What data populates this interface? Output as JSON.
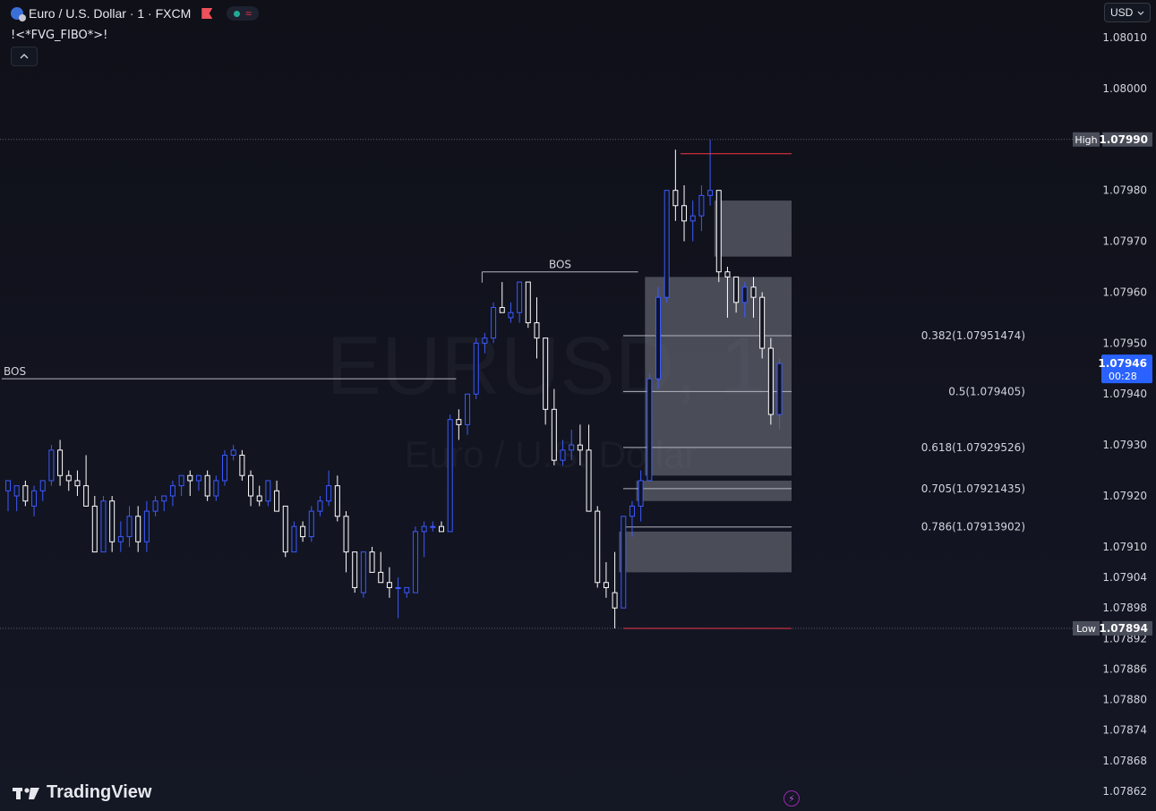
{
  "header": {
    "title": "Euro / U.S. Dollar · 1 · FXCM",
    "indicator": "!<*FVG_FIBO*>!",
    "currency": "USD"
  },
  "brand": {
    "logo_text": "TradingView"
  },
  "watermark": {
    "symbol": "EURUSD, 1",
    "description": "Euro / U.S. Dollar"
  },
  "colors": {
    "bg": "#121420",
    "bull_candle": "#3d5afe",
    "bear_candle": "#ffffff",
    "high_low_line": "#f23645",
    "zone": "#787b86",
    "price_tag": "#2962ff",
    "label_tag": "#4a4e5a"
  },
  "chart_data": {
    "type": "candlestick",
    "symbol": "EURUSD",
    "timeframe": "1",
    "ylim": [
      1.07859,
      1.08015
    ],
    "y_ticks": [
      "1.08010",
      "1.08000",
      "1.07980",
      "1.07970",
      "1.07960",
      "1.07950",
      "1.07940",
      "1.07930",
      "1.07920",
      "1.07910",
      "1.07904",
      "1.07898",
      "1.07892",
      "1.07886",
      "1.07880",
      "1.07874",
      "1.07868",
      "1.07862"
    ],
    "candles": [
      {
        "o": 1.07921,
        "h": 1.07923,
        "l": 1.07917,
        "c": 1.07923
      },
      {
        "o": 1.0792,
        "h": 1.07922,
        "l": 1.07917,
        "c": 1.07922
      },
      {
        "o": 1.07922,
        "h": 1.07923,
        "l": 1.07918,
        "c": 1.07919
      },
      {
        "o": 1.07918,
        "h": 1.07922,
        "l": 1.07916,
        "c": 1.07921
      },
      {
        "o": 1.07921,
        "h": 1.07923,
        "l": 1.07919,
        "c": 1.07923
      },
      {
        "o": 1.07923,
        "h": 1.0793,
        "l": 1.07922,
        "c": 1.07929
      },
      {
        "o": 1.07929,
        "h": 1.07931,
        "l": 1.07922,
        "c": 1.07924
      },
      {
        "o": 1.07924,
        "h": 1.07925,
        "l": 1.07921,
        "c": 1.07923
      },
      {
        "o": 1.07923,
        "h": 1.07925,
        "l": 1.0792,
        "c": 1.07922
      },
      {
        "o": 1.07922,
        "h": 1.07928,
        "l": 1.07918,
        "c": 1.07918
      },
      {
        "o": 1.07918,
        "h": 1.0792,
        "l": 1.07909,
        "c": 1.07909
      },
      {
        "o": 1.07909,
        "h": 1.0792,
        "l": 1.07909,
        "c": 1.07919
      },
      {
        "o": 1.07919,
        "h": 1.0792,
        "l": 1.07909,
        "c": 1.07911
      },
      {
        "o": 1.07911,
        "h": 1.07915,
        "l": 1.07909,
        "c": 1.07912
      },
      {
        "o": 1.07912,
        "h": 1.07918,
        "l": 1.0791,
        "c": 1.07916
      },
      {
        "o": 1.07916,
        "h": 1.07918,
        "l": 1.07909,
        "c": 1.07911
      },
      {
        "o": 1.07911,
        "h": 1.07919,
        "l": 1.07909,
        "c": 1.07917
      },
      {
        "o": 1.07917,
        "h": 1.0792,
        "l": 1.07916,
        "c": 1.07919
      },
      {
        "o": 1.07919,
        "h": 1.0792,
        "l": 1.07917,
        "c": 1.0792
      },
      {
        "o": 1.0792,
        "h": 1.07923,
        "l": 1.07918,
        "c": 1.07922
      },
      {
        "o": 1.07922,
        "h": 1.07924,
        "l": 1.0792,
        "c": 1.07924
      },
      {
        "o": 1.07924,
        "h": 1.07925,
        "l": 1.0792,
        "c": 1.07923
      },
      {
        "o": 1.07923,
        "h": 1.07924,
        "l": 1.07921,
        "c": 1.07924
      },
      {
        "o": 1.07924,
        "h": 1.07925,
        "l": 1.07919,
        "c": 1.0792
      },
      {
        "o": 1.0792,
        "h": 1.07924,
        "l": 1.07919,
        "c": 1.07923
      },
      {
        "o": 1.07923,
        "h": 1.07929,
        "l": 1.07922,
        "c": 1.07928
      },
      {
        "o": 1.07928,
        "h": 1.0793,
        "l": 1.07927,
        "c": 1.07929
      },
      {
        "o": 1.07928,
        "h": 1.07929,
        "l": 1.07923,
        "c": 1.07924
      },
      {
        "o": 1.07924,
        "h": 1.07925,
        "l": 1.07918,
        "c": 1.0792
      },
      {
        "o": 1.0792,
        "h": 1.07922,
        "l": 1.07918,
        "c": 1.07919
      },
      {
        "o": 1.07919,
        "h": 1.07923,
        "l": 1.07918,
        "c": 1.07923
      },
      {
        "o": 1.07921,
        "h": 1.07923,
        "l": 1.07917,
        "c": 1.07917
      },
      {
        "o": 1.07918,
        "h": 1.07918,
        "l": 1.07908,
        "c": 1.07909
      },
      {
        "o": 1.07909,
        "h": 1.07915,
        "l": 1.07909,
        "c": 1.07914
      },
      {
        "o": 1.07914,
        "h": 1.07915,
        "l": 1.07911,
        "c": 1.07912
      },
      {
        "o": 1.07912,
        "h": 1.07918,
        "l": 1.07911,
        "c": 1.07917
      },
      {
        "o": 1.07917,
        "h": 1.0792,
        "l": 1.07916,
        "c": 1.07919
      },
      {
        "o": 1.07919,
        "h": 1.07925,
        "l": 1.07918,
        "c": 1.07922
      },
      {
        "o": 1.07922,
        "h": 1.07924,
        "l": 1.07915,
        "c": 1.07916
      },
      {
        "o": 1.07916,
        "h": 1.07917,
        "l": 1.07905,
        "c": 1.07909
      },
      {
        "o": 1.07909,
        "h": 1.07909,
        "l": 1.07901,
        "c": 1.07902
      },
      {
        "o": 1.07901,
        "h": 1.07909,
        "l": 1.079,
        "c": 1.07909
      },
      {
        "o": 1.07909,
        "h": 1.0791,
        "l": 1.07905,
        "c": 1.07905
      },
      {
        "o": 1.07905,
        "h": 1.07909,
        "l": 1.07903,
        "c": 1.07903
      },
      {
        "o": 1.07903,
        "h": 1.07906,
        "l": 1.079,
        "c": 1.07902
      },
      {
        "o": 1.07902,
        "h": 1.07904,
        "l": 1.07896,
        "c": 1.07902
      },
      {
        "o": 1.07901,
        "h": 1.07902,
        "l": 1.079,
        "c": 1.07902
      },
      {
        "o": 1.07901,
        "h": 1.07914,
        "l": 1.07901,
        "c": 1.07913
      },
      {
        "o": 1.07913,
        "h": 1.07915,
        "l": 1.07908,
        "c": 1.07914
      },
      {
        "o": 1.07914,
        "h": 1.07915,
        "l": 1.07913,
        "c": 1.07914
      },
      {
        "o": 1.07914,
        "h": 1.07915,
        "l": 1.07913,
        "c": 1.07913
      },
      {
        "o": 1.07913,
        "h": 1.07936,
        "l": 1.07913,
        "c": 1.07935
      },
      {
        "o": 1.07935,
        "h": 1.07937,
        "l": 1.07931,
        "c": 1.07934
      },
      {
        "o": 1.07934,
        "h": 1.0794,
        "l": 1.07932,
        "c": 1.0794
      },
      {
        "o": 1.0794,
        "h": 1.07951,
        "l": 1.07939,
        "c": 1.0795
      },
      {
        "o": 1.0795,
        "h": 1.07952,
        "l": 1.07948,
        "c": 1.07951
      },
      {
        "o": 1.07951,
        "h": 1.07958,
        "l": 1.0795,
        "c": 1.07957
      },
      {
        "o": 1.07957,
        "h": 1.07962,
        "l": 1.07956,
        "c": 1.07956
      },
      {
        "o": 1.07955,
        "h": 1.07958,
        "l": 1.07954,
        "c": 1.07956
      },
      {
        "o": 1.07956,
        "h": 1.07961,
        "l": 1.07954,
        "c": 1.07962
      },
      {
        "o": 1.07962,
        "h": 1.07961,
        "l": 1.07953,
        "c": 1.07954
      },
      {
        "o": 1.07954,
        "h": 1.07959,
        "l": 1.07947,
        "c": 1.07951
      },
      {
        "o": 1.07951,
        "h": 1.07951,
        "l": 1.07934,
        "c": 1.07937
      },
      {
        "o": 1.07937,
        "h": 1.07941,
        "l": 1.07926,
        "c": 1.07927
      },
      {
        "o": 1.07927,
        "h": 1.07931,
        "l": 1.07926,
        "c": 1.07929
      },
      {
        "o": 1.07929,
        "h": 1.07933,
        "l": 1.07927,
        "c": 1.0793
      },
      {
        "o": 1.0793,
        "h": 1.07934,
        "l": 1.07926,
        "c": 1.07929
      },
      {
        "o": 1.07929,
        "h": 1.07934,
        "l": 1.07918,
        "c": 1.07917
      },
      {
        "o": 1.07917,
        "h": 1.07918,
        "l": 1.07902,
        "c": 1.07903
      },
      {
        "o": 1.07903,
        "h": 1.07907,
        "l": 1.079,
        "c": 1.07902
      },
      {
        "o": 1.07901,
        "h": 1.07909,
        "l": 1.07894,
        "c": 1.07898
      },
      {
        "o": 1.07898,
        "h": 1.07916,
        "l": 1.07898,
        "c": 1.07916
      },
      {
        "o": 1.07916,
        "h": 1.07919,
        "l": 1.07912,
        "c": 1.07918
      },
      {
        "o": 1.07918,
        "h": 1.07925,
        "l": 1.07915,
        "c": 1.07923
      },
      {
        "o": 1.07923,
        "h": 1.07944,
        "l": 1.07923,
        "c": 1.07943
      },
      {
        "o": 1.07943,
        "h": 1.07961,
        "l": 1.07941,
        "c": 1.07959
      },
      {
        "o": 1.07959,
        "h": 1.0798,
        "l": 1.07958,
        "c": 1.0798
      },
      {
        "o": 1.0798,
        "h": 1.07988,
        "l": 1.07974,
        "c": 1.07977
      },
      {
        "o": 1.07977,
        "h": 1.07981,
        "l": 1.0797,
        "c": 1.07974
      },
      {
        "o": 1.07974,
        "h": 1.07978,
        "l": 1.0797,
        "c": 1.07975
      },
      {
        "o": 1.07975,
        "h": 1.07981,
        "l": 1.07972,
        "c": 1.07979
      },
      {
        "o": 1.07979,
        "h": 1.0799,
        "l": 1.07977,
        "c": 1.0798
      },
      {
        "o": 1.0798,
        "h": 1.0798,
        "l": 1.07962,
        "c": 1.07964
      },
      {
        "o": 1.07964,
        "h": 1.07965,
        "l": 1.07955,
        "c": 1.07963
      },
      {
        "o": 1.07963,
        "h": 1.07963,
        "l": 1.07956,
        "c": 1.07958
      },
      {
        "o": 1.07958,
        "h": 1.07962,
        "l": 1.07955,
        "c": 1.07961
      },
      {
        "o": 1.07961,
        "h": 1.07963,
        "l": 1.07955,
        "c": 1.07959
      },
      {
        "o": 1.07959,
        "h": 1.0796,
        "l": 1.07947,
        "c": 1.07949
      },
      {
        "o": 1.07949,
        "h": 1.07951,
        "l": 1.07934,
        "c": 1.07936
      },
      {
        "o": 1.07936,
        "h": 1.07947,
        "l": 1.07933,
        "c": 1.07946
      }
    ],
    "price_high": {
      "label": "High",
      "value": "1.07990"
    },
    "price_low": {
      "label": "Low",
      "value": "1.07894"
    },
    "last_price": {
      "value": "1.07946",
      "countdown": "00:28"
    },
    "bos": [
      {
        "label": "BOS",
        "level": 1.07943,
        "from_bar": 0,
        "to_bar": 52
      },
      {
        "label": "BOS",
        "level": 1.07964,
        "from_bar": 55,
        "to_bar": 73
      }
    ],
    "fib_levels": [
      {
        "label": "0.382(1.07951474)",
        "value": 1.07951474
      },
      {
        "label": "0.5(1.079405)",
        "value": 1.079405
      },
      {
        "label": "0.618(1.07929526)",
        "value": 1.07929526
      },
      {
        "label": "0.705(1.07921435)",
        "value": 1.07921435
      },
      {
        "label": "0.786(1.07913902)",
        "value": 1.07913902
      }
    ],
    "fvg_zones": [
      {
        "from_bar": 82,
        "top": 1.07978,
        "bottom": 1.07967
      },
      {
        "from_bar": 74,
        "top": 1.07963,
        "bottom": 1.07924
      },
      {
        "from_bar": 73,
        "top": 1.07923,
        "bottom": 1.07919
      },
      {
        "from_bar": 71,
        "top": 1.07913,
        "bottom": 1.07905
      }
    ]
  }
}
